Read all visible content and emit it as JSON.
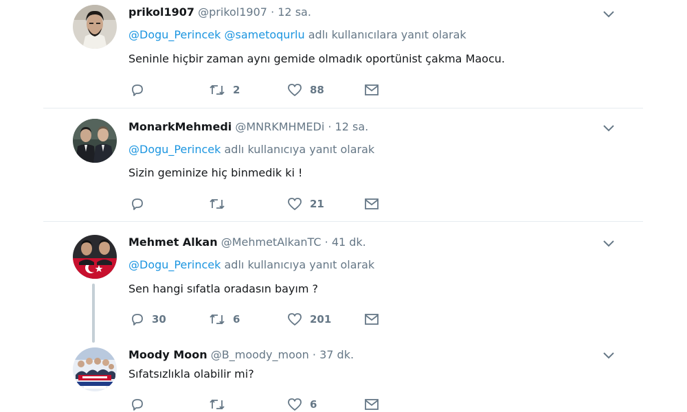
{
  "tweets": [
    {
      "name": "prikol1907",
      "handle": "@prikol1907",
      "sep": "·",
      "time": "12 sa.",
      "reply_mentions": [
        "@Dogu_Perincek",
        "@sametoqurlu"
      ],
      "reply_suffix": "adlı kullanıcılara yanıt olarak",
      "text": "Seninle hiçbir zaman aynı gemide olmadık oportünist çakma Maocu.",
      "replies": "",
      "retweets": "2",
      "likes": "88"
    },
    {
      "name": "MonarkMehmedi",
      "handle": "@MNRKMHMEDi",
      "sep": "·",
      "time": "12 sa.",
      "reply_mentions": [
        "@Dogu_Perincek"
      ],
      "reply_suffix": "adlı kullanıcıya yanıt olarak",
      "text": "Sizin geminize hiç binmedik ki !",
      "replies": "",
      "retweets": "",
      "likes": "21"
    },
    {
      "name": "Mehmet Alkan",
      "handle": "@MehmetAlkanTC",
      "sep": "·",
      "time": "41 dk.",
      "reply_mentions": [
        "@Dogu_Perincek"
      ],
      "reply_suffix": "adlı kullanıcıya yanıt olarak",
      "text": "Sen hangi sıfatla oradasın bayım ?",
      "replies": "30",
      "retweets": "6",
      "likes": "201"
    },
    {
      "name": "Moody Moon",
      "handle": "@B_moody_moon",
      "sep": "·",
      "time": "37 dk.",
      "text": "Sıfatsızlıkla olabilir mi?",
      "replies": "",
      "retweets": "",
      "likes": "6"
    }
  ],
  "icons": {
    "reply": "reply-icon",
    "retweet": "retweet-icon",
    "like": "heart-icon",
    "dm": "envelope-icon",
    "more": "chevron-down-icon"
  },
  "colors": {
    "link": "#1b95e0",
    "muted": "#657786",
    "text": "#14171a",
    "divider": "#e6ecf0",
    "thread": "#c4cfd6"
  }
}
